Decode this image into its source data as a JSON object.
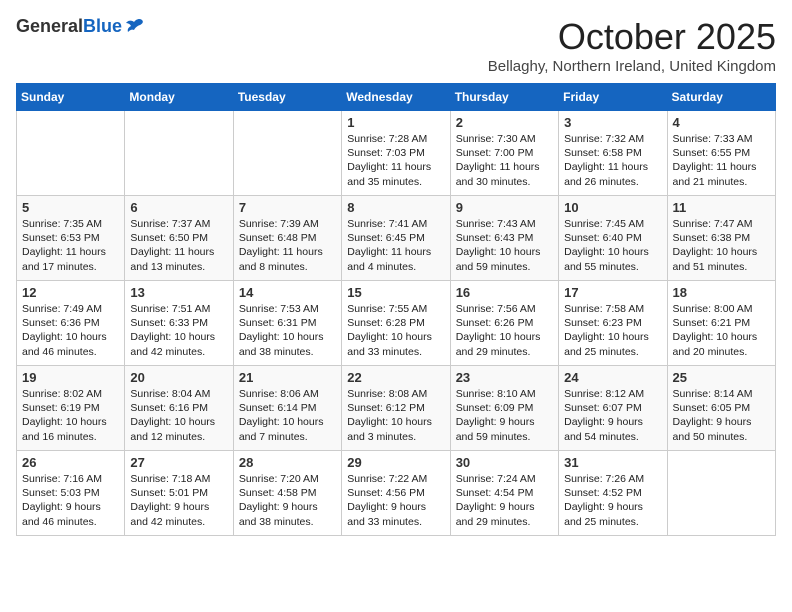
{
  "header": {
    "logo_general": "General",
    "logo_blue": "Blue",
    "month": "October 2025",
    "location": "Bellaghy, Northern Ireland, United Kingdom"
  },
  "days_of_week": [
    "Sunday",
    "Monday",
    "Tuesday",
    "Wednesday",
    "Thursday",
    "Friday",
    "Saturday"
  ],
  "weeks": [
    [
      {
        "day": "",
        "content": ""
      },
      {
        "day": "",
        "content": ""
      },
      {
        "day": "",
        "content": ""
      },
      {
        "day": "1",
        "content": "Sunrise: 7:28 AM\nSunset: 7:03 PM\nDaylight: 11 hours\nand 35 minutes."
      },
      {
        "day": "2",
        "content": "Sunrise: 7:30 AM\nSunset: 7:00 PM\nDaylight: 11 hours\nand 30 minutes."
      },
      {
        "day": "3",
        "content": "Sunrise: 7:32 AM\nSunset: 6:58 PM\nDaylight: 11 hours\nand 26 minutes."
      },
      {
        "day": "4",
        "content": "Sunrise: 7:33 AM\nSunset: 6:55 PM\nDaylight: 11 hours\nand 21 minutes."
      }
    ],
    [
      {
        "day": "5",
        "content": "Sunrise: 7:35 AM\nSunset: 6:53 PM\nDaylight: 11 hours\nand 17 minutes."
      },
      {
        "day": "6",
        "content": "Sunrise: 7:37 AM\nSunset: 6:50 PM\nDaylight: 11 hours\nand 13 minutes."
      },
      {
        "day": "7",
        "content": "Sunrise: 7:39 AM\nSunset: 6:48 PM\nDaylight: 11 hours\nand 8 minutes."
      },
      {
        "day": "8",
        "content": "Sunrise: 7:41 AM\nSunset: 6:45 PM\nDaylight: 11 hours\nand 4 minutes."
      },
      {
        "day": "9",
        "content": "Sunrise: 7:43 AM\nSunset: 6:43 PM\nDaylight: 10 hours\nand 59 minutes."
      },
      {
        "day": "10",
        "content": "Sunrise: 7:45 AM\nSunset: 6:40 PM\nDaylight: 10 hours\nand 55 minutes."
      },
      {
        "day": "11",
        "content": "Sunrise: 7:47 AM\nSunset: 6:38 PM\nDaylight: 10 hours\nand 51 minutes."
      }
    ],
    [
      {
        "day": "12",
        "content": "Sunrise: 7:49 AM\nSunset: 6:36 PM\nDaylight: 10 hours\nand 46 minutes."
      },
      {
        "day": "13",
        "content": "Sunrise: 7:51 AM\nSunset: 6:33 PM\nDaylight: 10 hours\nand 42 minutes."
      },
      {
        "day": "14",
        "content": "Sunrise: 7:53 AM\nSunset: 6:31 PM\nDaylight: 10 hours\nand 38 minutes."
      },
      {
        "day": "15",
        "content": "Sunrise: 7:55 AM\nSunset: 6:28 PM\nDaylight: 10 hours\nand 33 minutes."
      },
      {
        "day": "16",
        "content": "Sunrise: 7:56 AM\nSunset: 6:26 PM\nDaylight: 10 hours\nand 29 minutes."
      },
      {
        "day": "17",
        "content": "Sunrise: 7:58 AM\nSunset: 6:23 PM\nDaylight: 10 hours\nand 25 minutes."
      },
      {
        "day": "18",
        "content": "Sunrise: 8:00 AM\nSunset: 6:21 PM\nDaylight: 10 hours\nand 20 minutes."
      }
    ],
    [
      {
        "day": "19",
        "content": "Sunrise: 8:02 AM\nSunset: 6:19 PM\nDaylight: 10 hours\nand 16 minutes."
      },
      {
        "day": "20",
        "content": "Sunrise: 8:04 AM\nSunset: 6:16 PM\nDaylight: 10 hours\nand 12 minutes."
      },
      {
        "day": "21",
        "content": "Sunrise: 8:06 AM\nSunset: 6:14 PM\nDaylight: 10 hours\nand 7 minutes."
      },
      {
        "day": "22",
        "content": "Sunrise: 8:08 AM\nSunset: 6:12 PM\nDaylight: 10 hours\nand 3 minutes."
      },
      {
        "day": "23",
        "content": "Sunrise: 8:10 AM\nSunset: 6:09 PM\nDaylight: 9 hours\nand 59 minutes."
      },
      {
        "day": "24",
        "content": "Sunrise: 8:12 AM\nSunset: 6:07 PM\nDaylight: 9 hours\nand 54 minutes."
      },
      {
        "day": "25",
        "content": "Sunrise: 8:14 AM\nSunset: 6:05 PM\nDaylight: 9 hours\nand 50 minutes."
      }
    ],
    [
      {
        "day": "26",
        "content": "Sunrise: 7:16 AM\nSunset: 5:03 PM\nDaylight: 9 hours\nand 46 minutes."
      },
      {
        "day": "27",
        "content": "Sunrise: 7:18 AM\nSunset: 5:01 PM\nDaylight: 9 hours\nand 42 minutes."
      },
      {
        "day": "28",
        "content": "Sunrise: 7:20 AM\nSunset: 4:58 PM\nDaylight: 9 hours\nand 38 minutes."
      },
      {
        "day": "29",
        "content": "Sunrise: 7:22 AM\nSunset: 4:56 PM\nDaylight: 9 hours\nand 33 minutes."
      },
      {
        "day": "30",
        "content": "Sunrise: 7:24 AM\nSunset: 4:54 PM\nDaylight: 9 hours\nand 29 minutes."
      },
      {
        "day": "31",
        "content": "Sunrise: 7:26 AM\nSunset: 4:52 PM\nDaylight: 9 hours\nand 25 minutes."
      },
      {
        "day": "",
        "content": ""
      }
    ]
  ]
}
